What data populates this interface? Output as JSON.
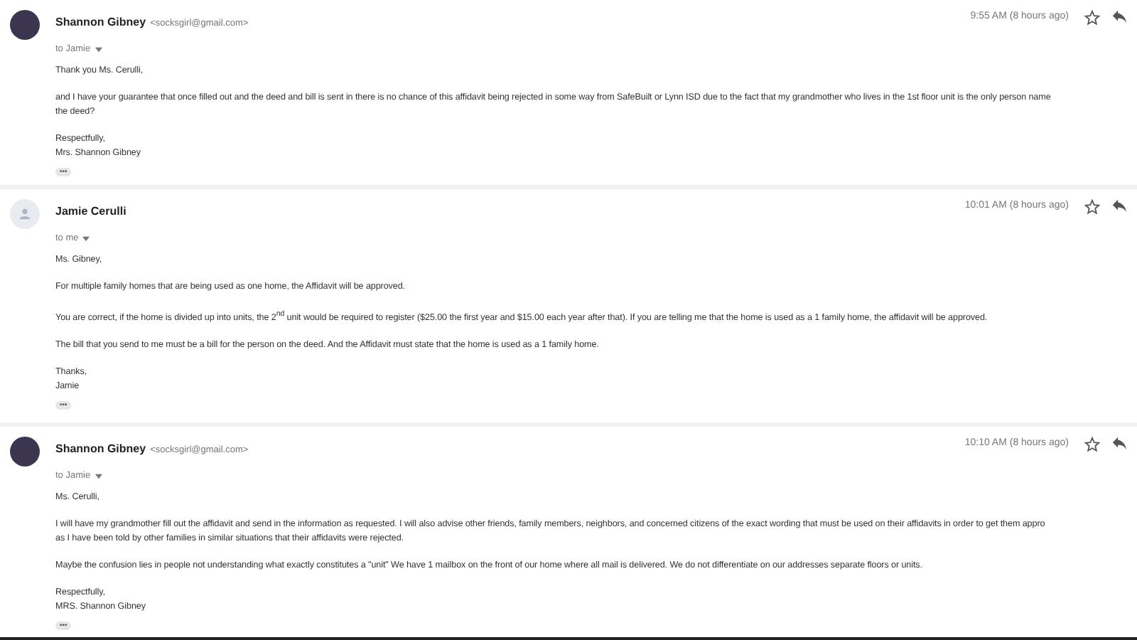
{
  "messages": [
    {
      "sender": "Shannon Gibney",
      "email": "<socksgirl@gmail.com>",
      "to": "to Jamie",
      "kind": "photo",
      "time": "9:55 AM (8 hours ago)",
      "starred": false,
      "paragraphs": [
        [
          "Thank you Ms. Cerulli,"
        ],
        [
          "and I have your guarantee that once filled out and the deed and bill is sent in there is no chance of this affidavit being rejected in some way from SafeBuilt or Lynn ISD due to the fact that my grandmother who lives in the 1st floor unit is the only person name",
          "the deed?"
        ],
        [
          "Respectfully,",
          "Mrs. Shannon Gibney"
        ]
      ],
      "more": "•••"
    },
    {
      "sender": "Jamie Cerulli",
      "to": "to me",
      "kind": "default",
      "time": "10:01 AM (8 hours ago)",
      "starred": false,
      "paragraphs": [
        [
          "Ms. Gibney,"
        ],
        [
          "For multiple family homes that are being used as one home, the Affidavit will be approved."
        ],
        [
          "You are correct, if the home is divided up into units, the 2$^{nd}$ unit would be required to register ($25.00 the first year and $15.00 each year after that).  If you are telling me that the home is used as a 1 family home, the affidavit will be approved."
        ],
        [
          "The bill that you send to me must be a bill for the person on the deed. And the Affidavit must state that the home is used as a 1 family home."
        ],
        [
          "Thanks,",
          "Jamie"
        ]
      ],
      "more": "•••"
    },
    {
      "sender": "Shannon Gibney",
      "email": "<socksgirl@gmail.com>",
      "to": "to Jamie",
      "kind": "photo",
      "time": "10:10 AM (8 hours ago)",
      "starred": false,
      "paragraphs": [
        [
          "Ms. Cerulli,"
        ],
        [
          "I will have my grandmother fill out the affidavit and send in the information as requested.  I will also advise other friends, family members, neighbors, and concerned citizens of the exact wording that must be used on their affidavits in order to get them appro",
          "as I have been told by other families in similar situations that their affidavits were rejected."
        ],
        [
          "Maybe the confusion lies in people not understanding what exactly constitutes a \"unit\"  We have 1 mailbox on the front of our home where all mail is delivered.  We do not differentiate on our addresses separate floors or units."
        ],
        [
          "Respectfully,",
          "MRS. Shannon Gibney"
        ]
      ],
      "more": "•••"
    }
  ]
}
